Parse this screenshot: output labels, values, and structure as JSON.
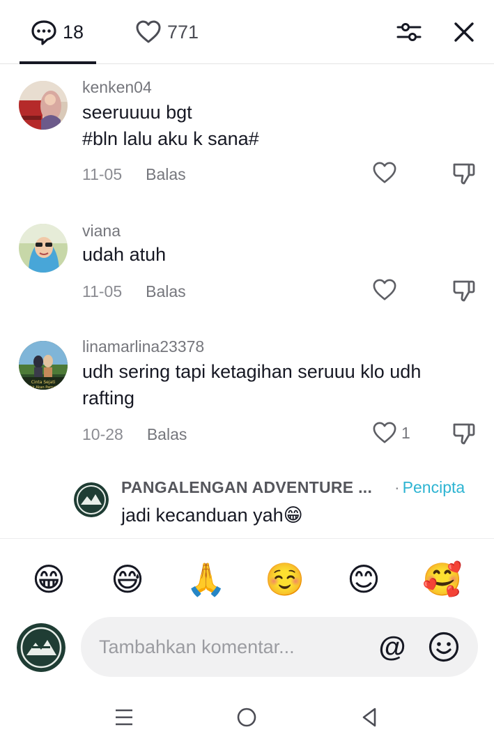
{
  "header": {
    "comments_count": "18",
    "likes_count": "771"
  },
  "comments": [
    {
      "username": "kenken04",
      "lines": [
        "seeruuuu bgt",
        "#bln lalu aku k sana#"
      ],
      "date": "11-05",
      "reply_label": "Balas",
      "like_count": ""
    },
    {
      "username": "viana",
      "lines": [
        "udah atuh"
      ],
      "date": "11-05",
      "reply_label": "Balas",
      "like_count": ""
    },
    {
      "username": "linamarlina23378",
      "lines": [
        "udh sering tapi ketagihan seruuu klo udh",
        "rafting"
      ],
      "date": "10-28",
      "reply_label": "Balas",
      "like_count": "1"
    }
  ],
  "reply": {
    "username": "PANGALENGAN ADVENTURE ...",
    "badge_dot": "·",
    "badge": "Pencipta",
    "text": "jadi kecanduan yah😁"
  },
  "quick_emojis": [
    "😁",
    "😅",
    "🙏",
    "☺️",
    "😊",
    "🥰"
  ],
  "composer": {
    "placeholder": "Tambahkan komentar...",
    "mention_symbol": "@"
  },
  "colors": {
    "creator_badge": "#2db4d2",
    "text_primary": "#161823",
    "text_secondary": "#75767c"
  }
}
